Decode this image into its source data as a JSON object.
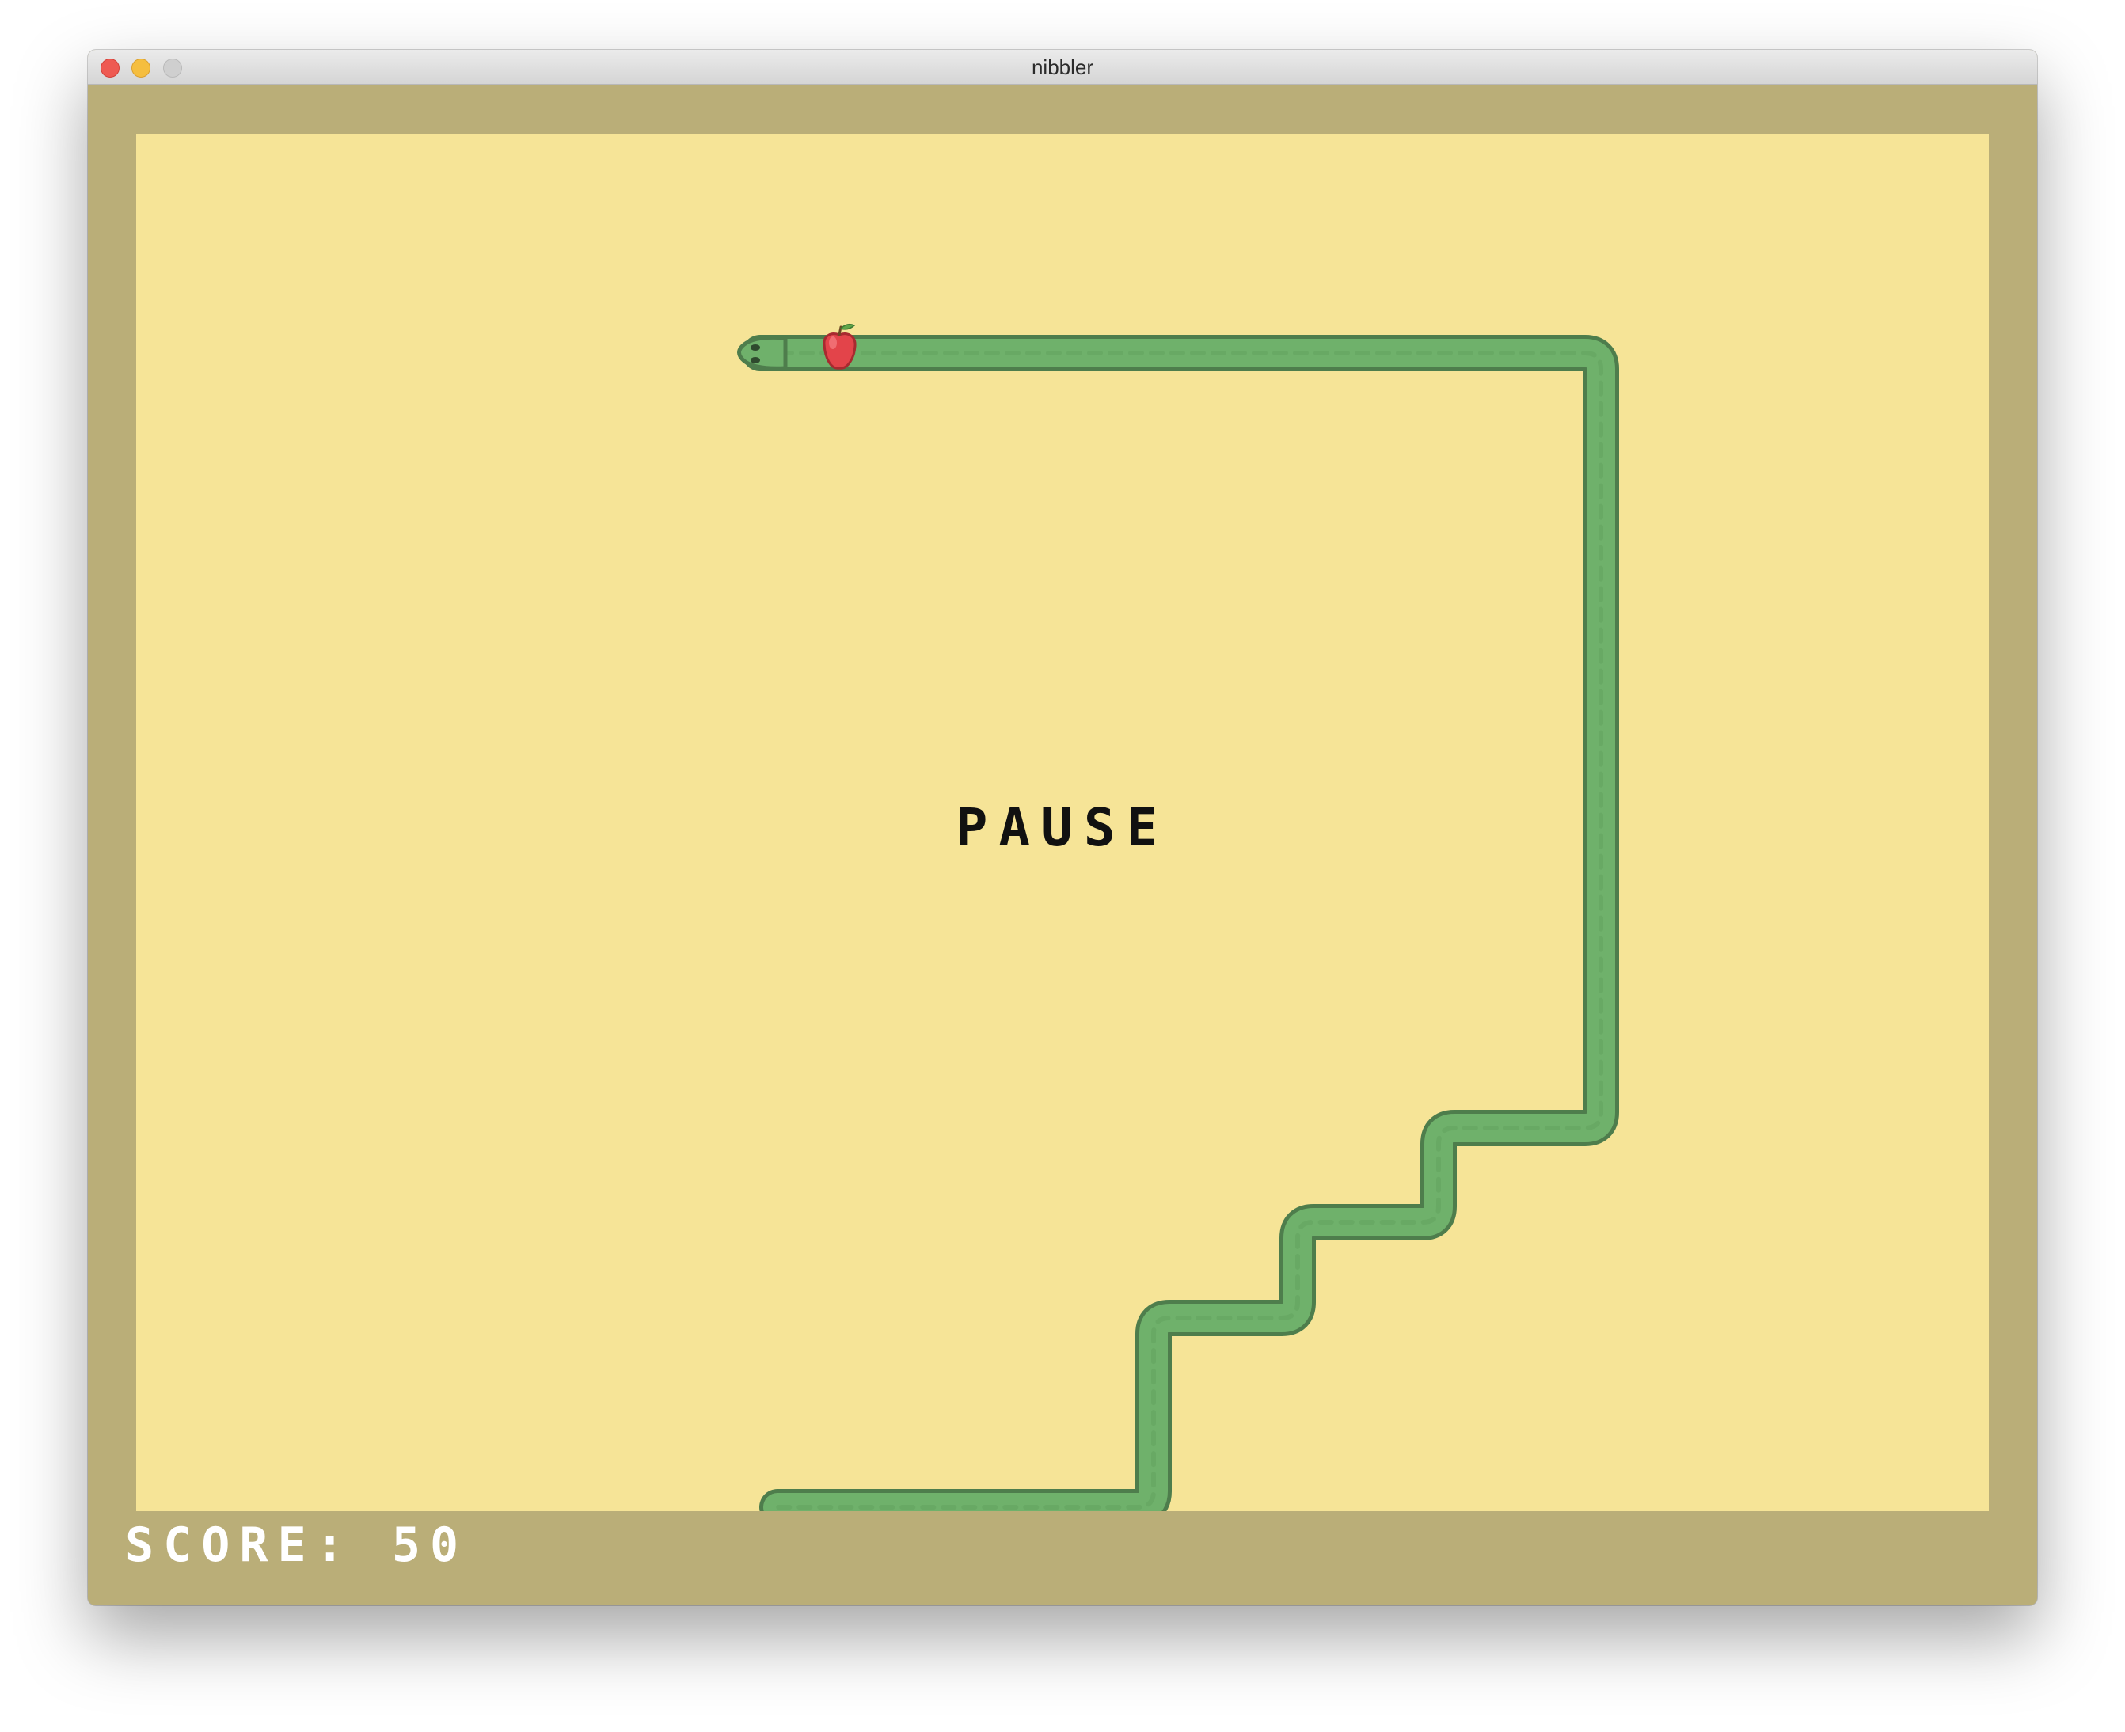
{
  "window": {
    "title": "nibbler"
  },
  "game": {
    "status_text": "PAUSE",
    "score_label": "SCORE:",
    "score_value": "50",
    "colors": {
      "border": "#baae78",
      "field": "#f6e497",
      "snake_body": "#6fb16b",
      "snake_outline": "#4e7d4c",
      "apple": "#e3444a",
      "text": "#111111",
      "score_text": "#ffffff"
    },
    "icons": {
      "food": "apple-icon",
      "player": "snake-head-icon"
    }
  }
}
